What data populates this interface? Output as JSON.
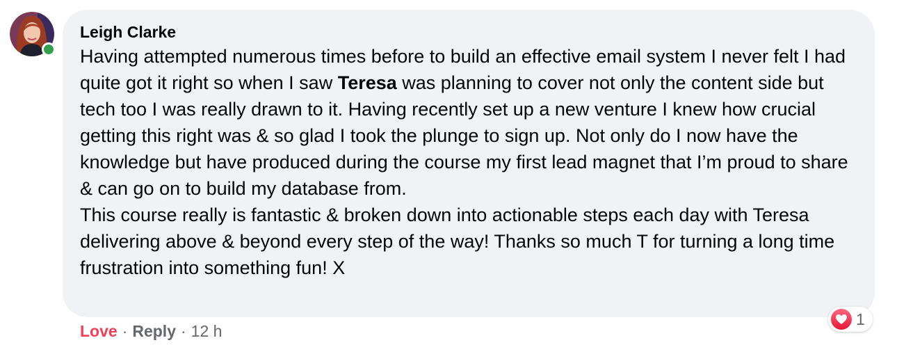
{
  "comment": {
    "author": "Leigh Clarke",
    "online": true,
    "paragraphs": [
      {
        "before_bold": "Having attempted numerous times before to build an effective email system I never felt I had quite got it right so when I saw ",
        "bold": "Teresa",
        "after_bold": " was planning to cover not only the content side but tech too I was really drawn to it. Having recently set up a new venture I knew how crucial getting this right was & so glad I took the plunge to sign up. Not only do I now have the knowledge but have produced during the course my first lead magnet that I’m proud to share & can go on to build my database from."
      },
      {
        "text": "This course really is fantastic & broken down into actionable steps each day with Teresa delivering above & beyond every step of the way! Thanks so much T for turning a long time frustration into something fun! X"
      }
    ],
    "reactions": {
      "icon": "heart-love-icon",
      "count": "1"
    },
    "actions": {
      "love_label": "Love",
      "reply_label": "Reply",
      "separator": "·",
      "time": "12 h"
    }
  },
  "colors": {
    "bubble_bg": "#f0f2f5",
    "love_active": "#f33e58",
    "meta_gray": "#65676b",
    "online_green": "#31a24c"
  }
}
